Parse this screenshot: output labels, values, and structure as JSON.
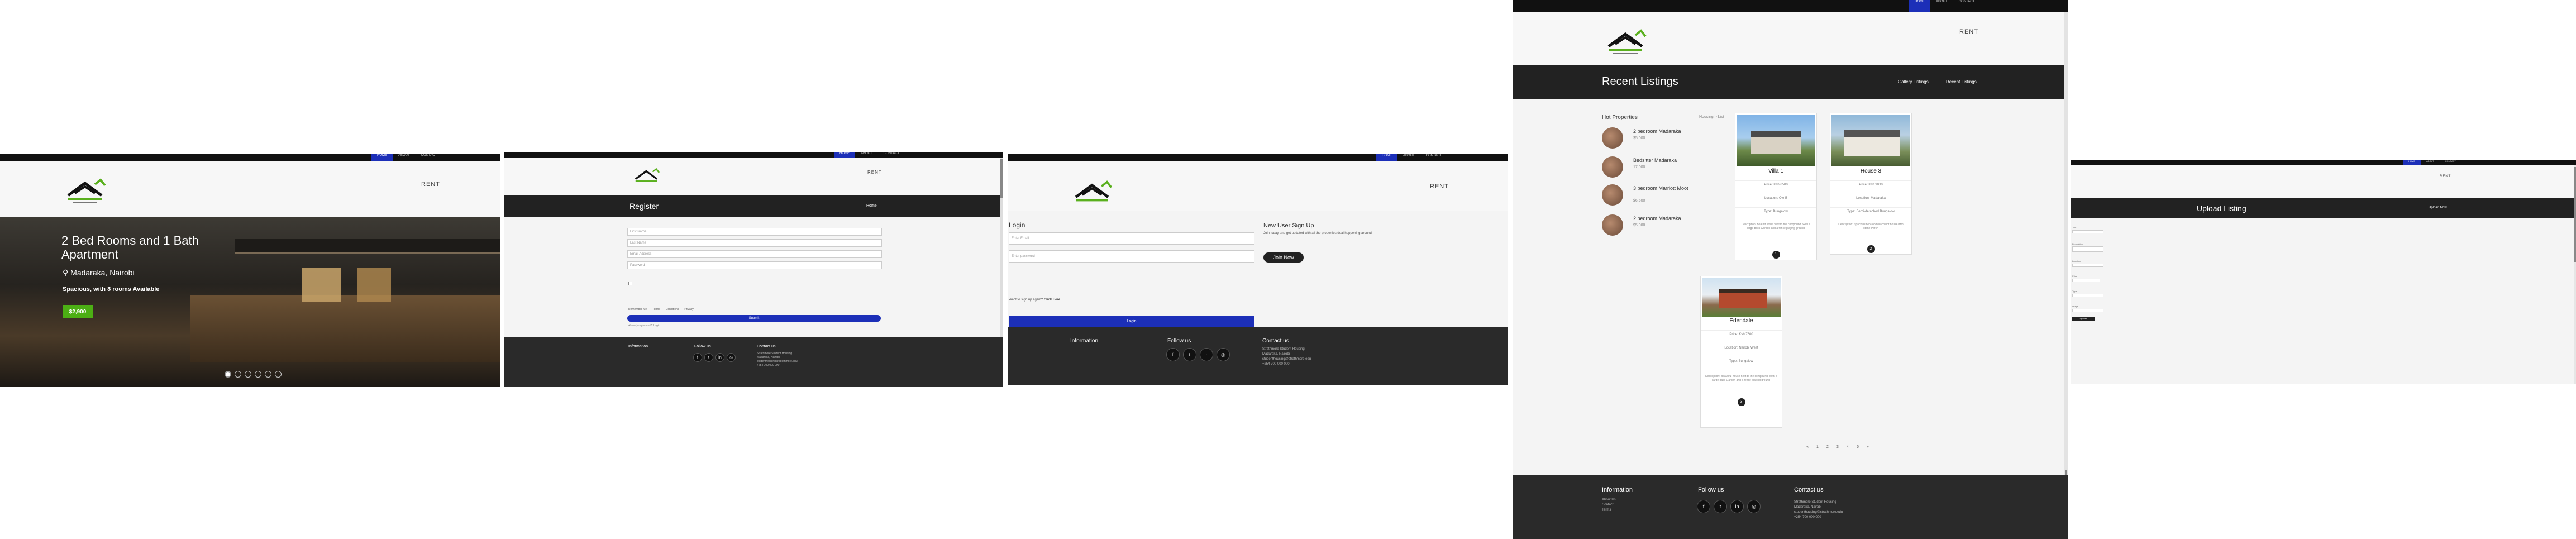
{
  "colors": {
    "accent": "#1c2fb8",
    "dark": "#222222",
    "price_green": "#4caf14",
    "topbar": "#111111",
    "footer": "#2a2a2a"
  },
  "nav": {
    "items": [
      "HOME",
      "ABOUT",
      "CONTACT"
    ],
    "rent_label": "RENT"
  },
  "hero": {
    "title": "2 Bed Rooms and 1 Bath Apartment",
    "location": "Madaraka, Nairobi",
    "tagline": "Spacious, with 8 rooms Available",
    "price": "$2,900",
    "location_icon": "map-pin-icon",
    "slide_count": 6
  },
  "register": {
    "title": "Register",
    "link": "Home",
    "fields": [
      "First Name",
      "Last Name",
      "Email Address",
      "Password"
    ],
    "remember": "Remember Me",
    "terms_links": [
      "Terms",
      "Conditions",
      "Privacy"
    ],
    "button": "Submit",
    "note": "Already registered? Login"
  },
  "login": {
    "title": "Login",
    "email_placeholder": "Enter Email",
    "password_placeholder": "Enter password",
    "signup_prompt": "Want to sign up again?",
    "signup_link": "Click Here",
    "button": "Login",
    "new_user_title": "New User Sign Up",
    "new_user_text": "Join today and get updated with all the properties deal happening around.",
    "join_button": "Join Now"
  },
  "listings": {
    "band_title": "Recent Listings",
    "band_links": [
      "Gallery Listings",
      "Recent Listings"
    ],
    "hot_title": "Hot Properties",
    "breadcrumb": "Housing > List",
    "hot": [
      {
        "name": "2 bedroom Madaraka",
        "price": "$5,000"
      },
      {
        "name": "Bedsitter Madaraka",
        "price": "17,000"
      },
      {
        "name": "3 bedroom Marriott Moot",
        "price": "$6,600"
      },
      {
        "name": "2 bedroom Madaraka",
        "price": "$5,000"
      }
    ],
    "cards": [
      {
        "title": "Villa 1",
        "rows": [
          "Price: Ksh 6500",
          "Location: Ole B",
          "Type: Bungalow"
        ],
        "desc": "Description: Beautiful villa next to the compound. With a large back Garden and a fence playing ground",
        "dot": "1"
      },
      {
        "title": "House 3",
        "rows": [
          "Price: Ksh 9000",
          "Location: Madaraka",
          "Type: Semi-detached Bungalow"
        ],
        "desc": "Description: Spacious two-room bachelor house with stone Porch",
        "dot": "2"
      },
      {
        "title": "Edendale",
        "rows": [
          "Price: Ksh 7600",
          "Location: Nairobi West",
          "Type: Bungalow"
        ],
        "desc": "Description: Beautiful house next to the compound. With a large back Garden and a fence playing ground",
        "dot": "3"
      }
    ],
    "pagination": [
      "«",
      "1",
      "2",
      "3",
      "4",
      "5",
      "»"
    ]
  },
  "upload": {
    "band_title": "Upload Listing",
    "band_link": "Upload Now",
    "labels": [
      "Title",
      "Description",
      "Location",
      "Price",
      "Type",
      "Image"
    ],
    "button": "Upload"
  },
  "footer": {
    "info_title": "Information",
    "info_items": [
      "About Us",
      "Contact",
      "Terms"
    ],
    "follow_title": "Follow us",
    "social_icons": [
      "facebook-icon",
      "twitter-icon",
      "linkedin-icon",
      "instagram-icon"
    ],
    "social_glyphs": [
      "f",
      "t",
      "in",
      "◎"
    ],
    "contact_title": "Contact us",
    "contact_lines": [
      "Strathmore Student Housing",
      "Madaraka, Nairobi",
      "studenthousing@strathmore.edu",
      "+254 700 000 000"
    ]
  }
}
